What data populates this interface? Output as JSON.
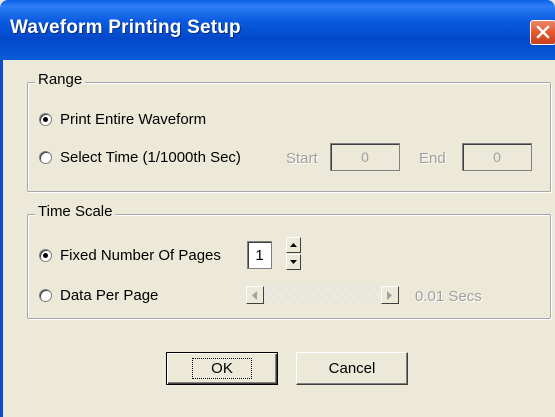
{
  "window": {
    "title": "Waveform Printing Setup"
  },
  "range": {
    "group_label": "Range",
    "option_entire": "Print Entire Waveform",
    "option_select": "Select Time (1/1000th Sec)",
    "selected": "entire",
    "start_label": "Start",
    "start_value": "0",
    "end_label": "End",
    "end_value": "0"
  },
  "time_scale": {
    "group_label": "Time Scale",
    "option_fixed": "Fixed Number Of Pages",
    "pages_value": "1",
    "option_data": "Data Per Page",
    "selected": "fixed",
    "data_per_page_value": "0.01 Secs"
  },
  "buttons": {
    "ok": "OK",
    "cancel": "Cancel"
  }
}
